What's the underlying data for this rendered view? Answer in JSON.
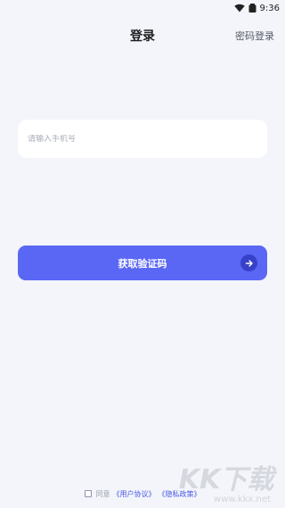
{
  "status_bar": {
    "time": "9:36"
  },
  "header": {
    "title": "登录",
    "password_login": "密码登录"
  },
  "phone_input": {
    "placeholder": "请输入手机号",
    "value": ""
  },
  "get_code_button": {
    "label": "获取验证码"
  },
  "agreement": {
    "prefix": "同意",
    "user_agreement": "《用户协议》",
    "privacy_policy": "《隐私政策》"
  },
  "watermark": {
    "text": "KK下载",
    "url": "www.kkx.net"
  },
  "colors": {
    "accent": "#5a67f5",
    "background": "#f3f5fa",
    "link": "#4a58e8"
  }
}
